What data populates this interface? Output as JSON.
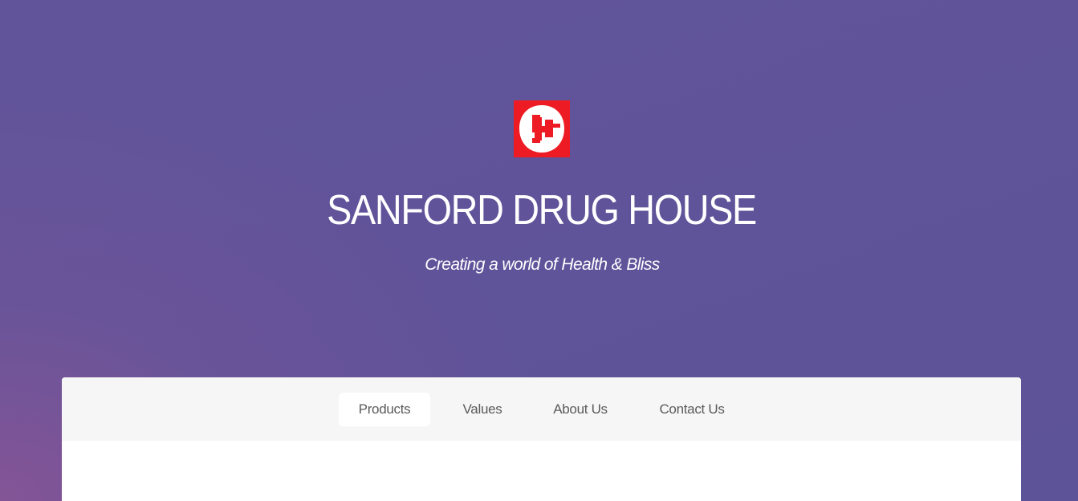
{
  "header": {
    "logo_icon": "sanford-sh-logo",
    "logo_color": "#ed1c24",
    "title": "SANFORD DRUG HOUSE",
    "tagline": "Creating a world of Health & Bliss"
  },
  "nav": {
    "items": [
      {
        "label": "Products",
        "active": true
      },
      {
        "label": "Values",
        "active": false
      },
      {
        "label": "About Us",
        "active": false
      },
      {
        "label": "Contact Us",
        "active": false
      }
    ]
  },
  "colors": {
    "background": "#5f5399",
    "background_accent": "#8a5596",
    "nav_bar": "#f6f6f6",
    "nav_text": "#5a5a5a",
    "panel": "#ffffff"
  }
}
